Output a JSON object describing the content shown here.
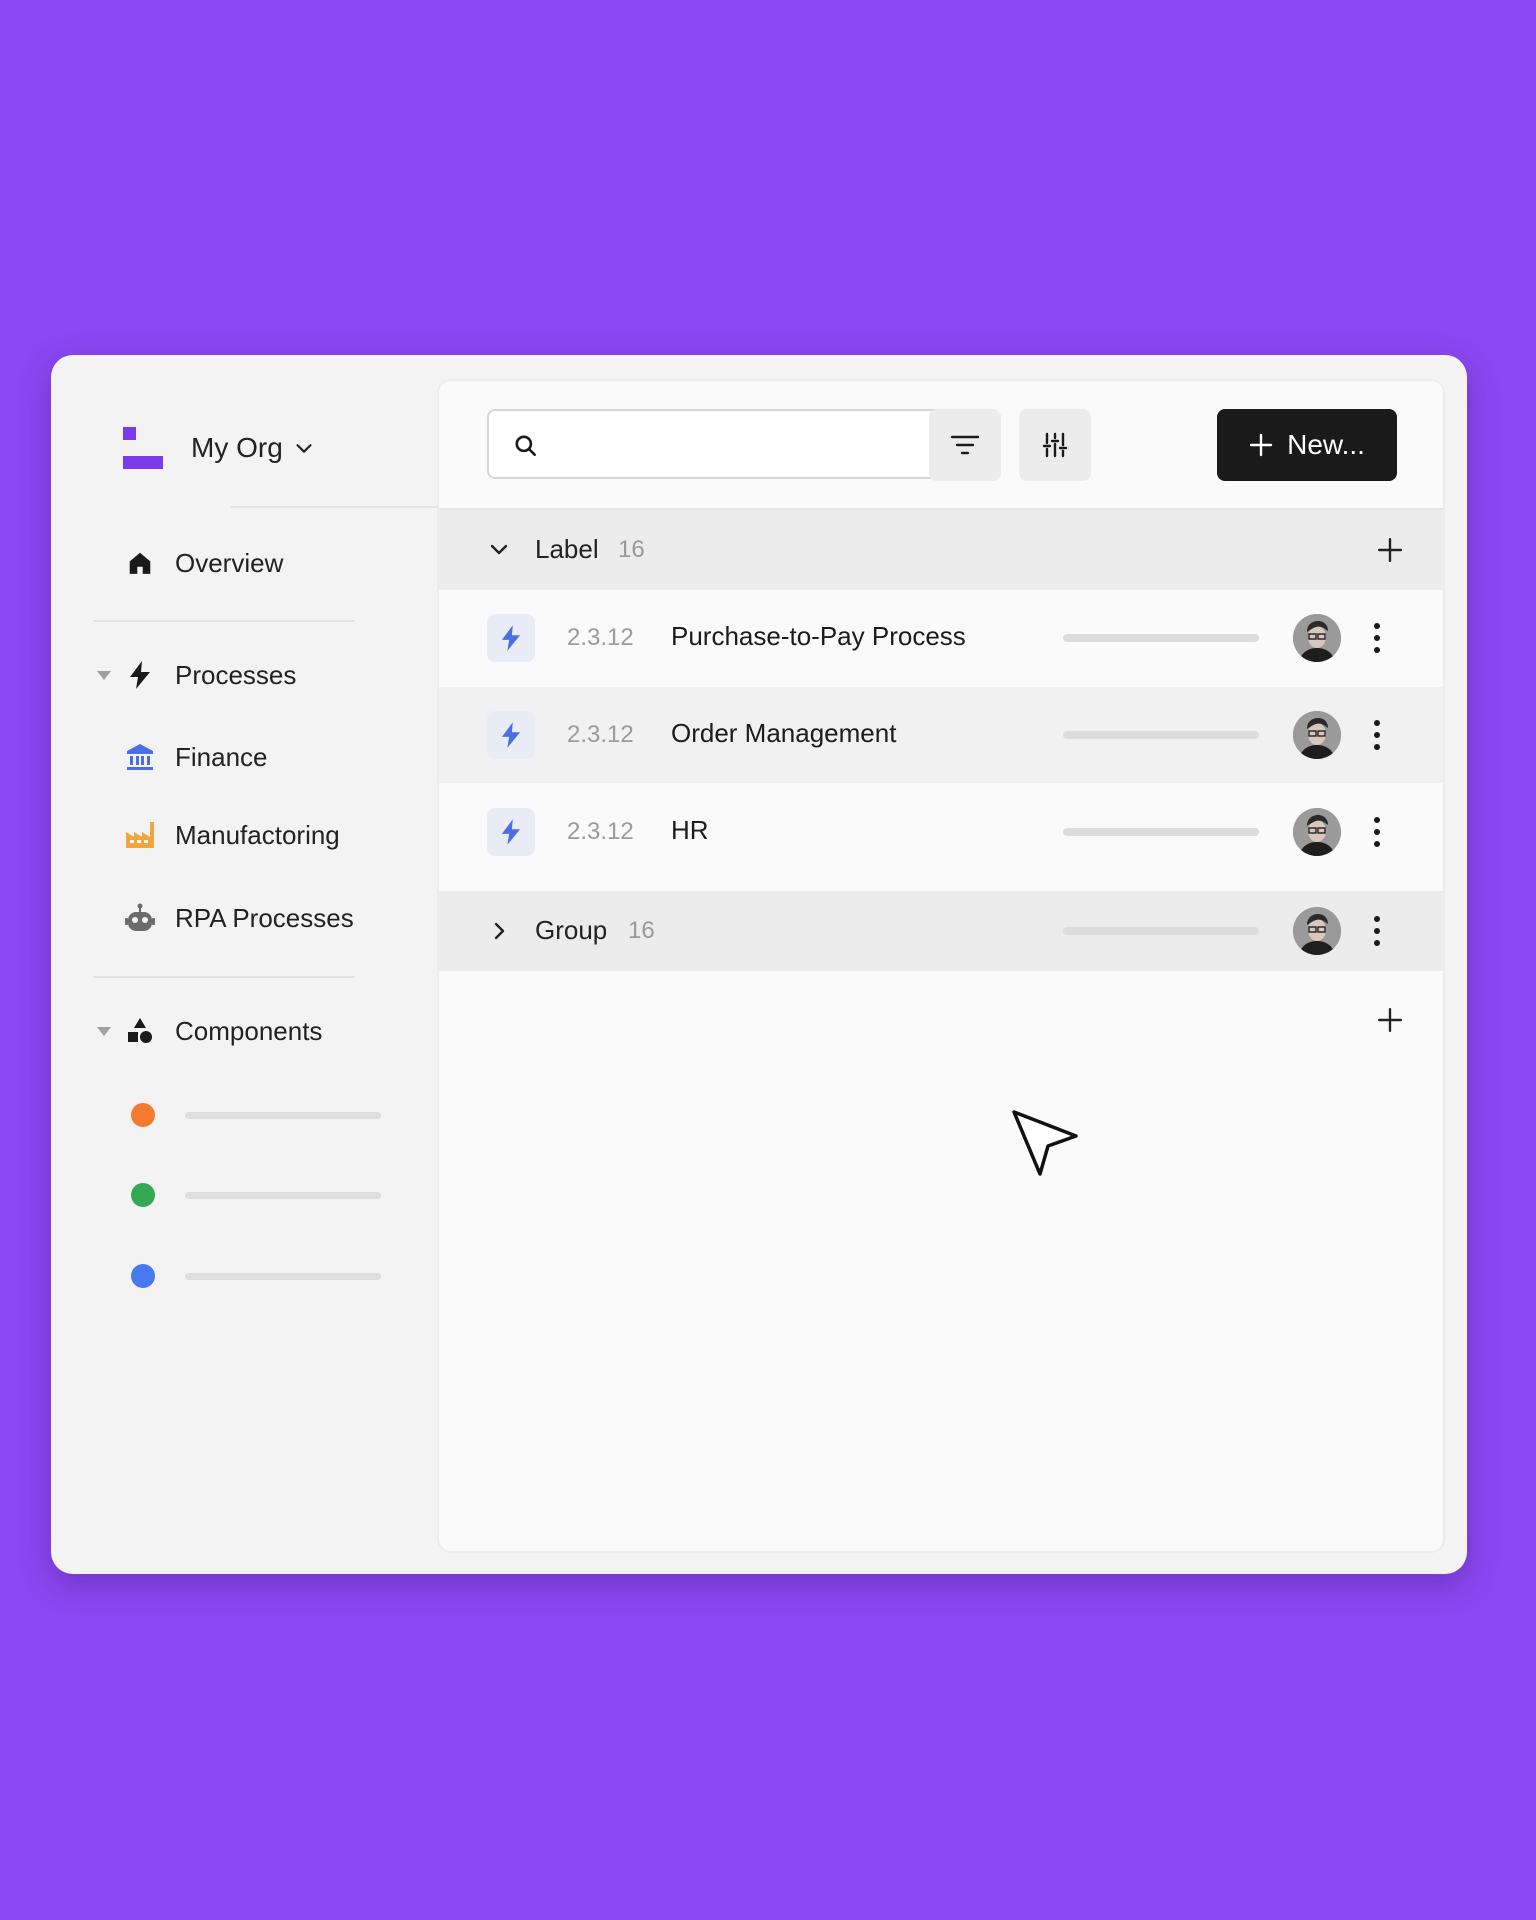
{
  "org": {
    "name": "My Org"
  },
  "nav": {
    "overview": "Overview",
    "processes": "Processes",
    "finance": "Finance",
    "manufactoring": "Manufactoring",
    "rpa": "RPA Processes",
    "components": "Components"
  },
  "components": [
    {
      "color": "#f47a32"
    },
    {
      "color": "#35a853"
    },
    {
      "color": "#4a78ee"
    }
  ],
  "search": {
    "placeholder": ""
  },
  "toolbar": {
    "new_label": "New..."
  },
  "groups": [
    {
      "title": "Label",
      "count": "16",
      "expanded": true
    },
    {
      "title": "Group",
      "count": "16",
      "expanded": false
    }
  ],
  "rows": [
    {
      "version": "2.3.12",
      "name": "Purchase-to-Pay Process"
    },
    {
      "version": "2.3.12",
      "name": "Order Management"
    },
    {
      "version": "2.3.12",
      "name": "HR"
    }
  ],
  "icons": {
    "brand": "#7c3aed",
    "accent": "#4a6ee6"
  }
}
